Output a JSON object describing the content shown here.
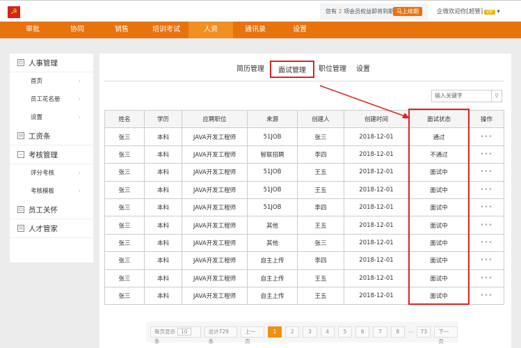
{
  "topbar": {
    "logo_icon": "party-emblem",
    "notice_prefix": "您有",
    "notice_count": "2",
    "notice_suffix": "项会员权益即将到期",
    "renew": "马上续期",
    "welcome": "企微欢迎你[超管]",
    "vip": "VIP"
  },
  "nav": [
    "审批",
    "协同",
    "销售",
    "培训考试",
    "人资",
    "通讯录",
    "设置"
  ],
  "sidebar": {
    "groups": [
      {
        "label": "人事管理",
        "icon": "user-icon",
        "items": [
          "首页",
          "员工花名册",
          "设置"
        ]
      },
      {
        "label": "工资条",
        "icon": "mail-icon",
        "items": []
      },
      {
        "label": "考核管理",
        "icon": "chart-icon",
        "items": [
          "评分考核",
          "考核模板"
        ]
      },
      {
        "label": "员工关怀",
        "icon": "person-icon",
        "items": []
      },
      {
        "label": "人才管家",
        "icon": "box-icon",
        "items": []
      }
    ]
  },
  "tabs": [
    "简历管理",
    "面试管理",
    "职位管理",
    "设置"
  ],
  "search": {
    "placeholder": "输入关键字"
  },
  "table": {
    "headers": [
      "姓名",
      "学历",
      "应聘职位",
      "来源",
      "创建人",
      "创建时间",
      "面试状态",
      "操作"
    ],
    "rows": [
      [
        "张三",
        "本科",
        "JAVA开发工程师",
        "51JOB",
        "张三",
        "2018-12-01",
        "通过"
      ],
      [
        "张三",
        "本科",
        "JAVA开发工程师",
        "智联招聘",
        "李四",
        "2018-12-01",
        "不通过"
      ],
      [
        "张三",
        "本科",
        "JAVA开发工程师",
        "51JOB",
        "王五",
        "2018-12-01",
        "面试中"
      ],
      [
        "张三",
        "本科",
        "JAVA开发工程师",
        "51JOB",
        "王五",
        "2018-12-01",
        "面试中"
      ],
      [
        "张三",
        "本科",
        "JAVA开发工程师",
        "51JOB",
        "李四",
        "2018-12-01",
        "面试中"
      ],
      [
        "张三",
        "本科",
        "JAVA开发工程师",
        "其他",
        "王五",
        "2018-12-01",
        "面试中"
      ],
      [
        "张三",
        "本科",
        "JAVA开发工程师",
        "其他",
        "张三",
        "2018-12-01",
        "面试中"
      ],
      [
        "张三",
        "本科",
        "JAVA开发工程师",
        "自主上传",
        "李四",
        "2018-12-01",
        "面试中"
      ],
      [
        "张三",
        "本科",
        "JAVA开发工程师",
        "自主上传",
        "王五",
        "2018-12-01",
        "面试中"
      ],
      [
        "张三",
        "本科",
        "JAVA开发工程师",
        "自主上传",
        "王五",
        "2018-12-01",
        "面试中"
      ]
    ],
    "action": "•••"
  },
  "pager": {
    "per_page_label": "每页显示",
    "per_page": "10",
    "unit": "条",
    "total": "总计729条",
    "prev": "上一页",
    "pages": [
      "1",
      "2",
      "3",
      "4",
      "5",
      "6",
      "7",
      "8"
    ],
    "ellipsis": "···",
    "last": "73",
    "next": "下一页"
  },
  "colors": {
    "accent": "#e8720c",
    "highlight": "#e02020"
  }
}
